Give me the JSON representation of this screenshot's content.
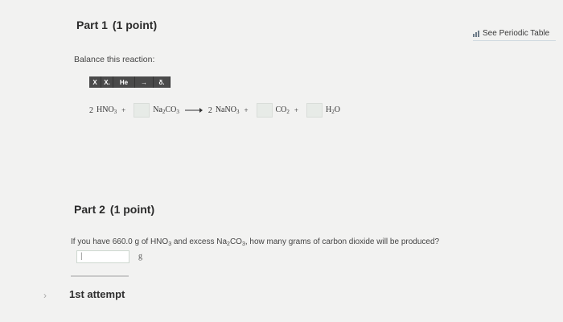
{
  "part1": {
    "title": "Part 1",
    "points": "(1 point)"
  },
  "periodic_link": {
    "label": "See Periodic Table",
    "icon": "periodic-table-icon"
  },
  "instructions": "Balance this reaction:",
  "toolbar": {
    "buttons": [
      {
        "label": "X",
        "name": "toolbar-x-button"
      },
      {
        "label": "X.",
        "name": "toolbar-subscript-button"
      },
      {
        "label": "He",
        "name": "toolbar-element-button"
      },
      {
        "label": "→",
        "name": "toolbar-arrow-button"
      },
      {
        "label": "δ.",
        "name": "toolbar-delta-button"
      }
    ]
  },
  "equation": {
    "hno3": {
      "coef": "2",
      "formula": "HNO",
      "sub": "3"
    },
    "na2co3": {
      "a": "Na",
      "s1": "2",
      "b": "CO",
      "s2": "3"
    },
    "nano3": {
      "coef": "2",
      "formula": "NaNO",
      "sub": "3"
    },
    "co2": {
      "formula": "CO",
      "sub": "2"
    },
    "h2o": {
      "a": "H",
      "s": "2",
      "b": "O"
    },
    "plus": "+"
  },
  "part2": {
    "title": "Part 2",
    "points": "(1 point)"
  },
  "question": {
    "pre": "If you have 660.0 g of HNO",
    "sub1": "3",
    "mid": " and excess Na",
    "sub2": "2",
    "mid2": "CO",
    "sub3": "3",
    "post": ", how many grams of carbon dioxide will be produced?"
  },
  "answer": {
    "value": "|",
    "unit": "g"
  },
  "attempt": {
    "label": "1st attempt",
    "icon": "chevron-right-icon"
  }
}
